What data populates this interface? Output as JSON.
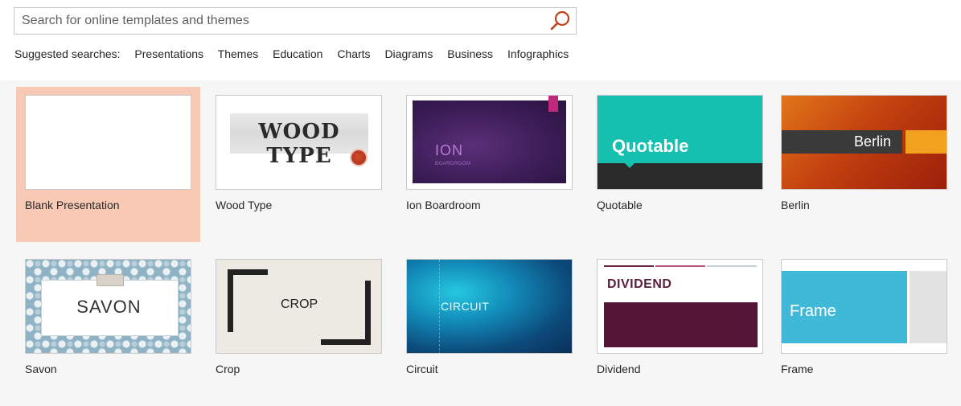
{
  "search": {
    "placeholder": "Search for online templates and themes",
    "value": "",
    "icon": "magnifier-icon"
  },
  "suggested": {
    "label": "Suggested searches:",
    "links": [
      "Presentations",
      "Themes",
      "Education",
      "Charts",
      "Diagrams",
      "Business",
      "Infographics"
    ]
  },
  "templates": [
    {
      "name": "Blank Presentation",
      "selected": true
    },
    {
      "name": "Wood Type",
      "thumb_text": "WOOD TYPE"
    },
    {
      "name": "Ion Boardroom",
      "thumb_text": "ION",
      "thumb_subtext": "BOARDROOM"
    },
    {
      "name": "Quotable",
      "thumb_text": "Quotable"
    },
    {
      "name": "Berlin",
      "thumb_text": "Berlin"
    },
    {
      "name": "Savon",
      "thumb_text": "SAVON"
    },
    {
      "name": "Crop",
      "thumb_text": "CROP"
    },
    {
      "name": "Circuit",
      "thumb_text": "CIRCUIT"
    },
    {
      "name": "Dividend",
      "thumb_text": "DIVIDEND"
    },
    {
      "name": "Frame",
      "thumb_text": "Frame"
    }
  ],
  "colors": {
    "selected_tile": "#f8c9b4",
    "search_icon": "#c0421c",
    "background": "#f6f6f6"
  }
}
